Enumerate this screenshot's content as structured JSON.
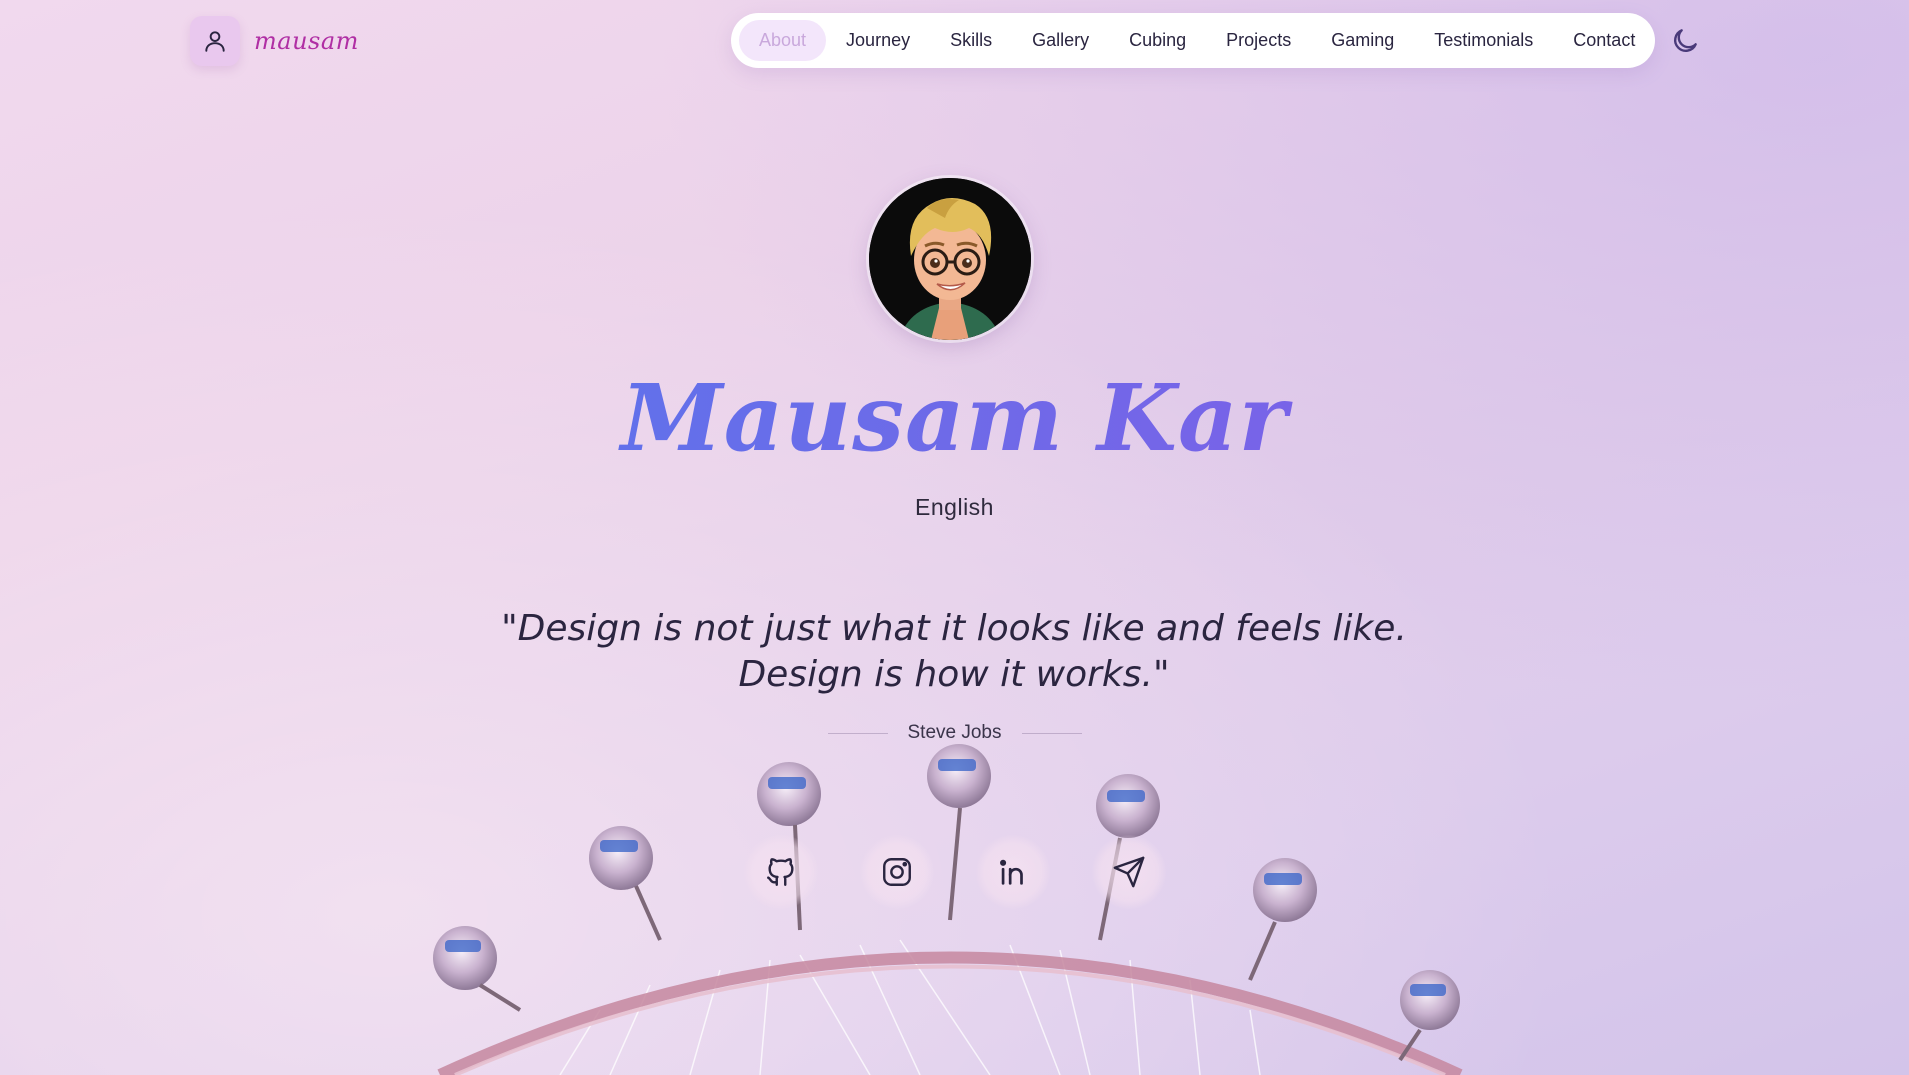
{
  "brand": {
    "name": "mausam",
    "icon": "user-icon"
  },
  "nav": {
    "items": [
      {
        "label": "About",
        "active": true
      },
      {
        "label": "Journey"
      },
      {
        "label": "Skills"
      },
      {
        "label": "Gallery"
      },
      {
        "label": "Cubing"
      },
      {
        "label": "Projects"
      },
      {
        "label": "Gaming"
      },
      {
        "label": "Testimonials"
      },
      {
        "label": "Contact"
      }
    ],
    "theme_toggle_icon": "moon-icon"
  },
  "hero": {
    "name": "Mausam Kar",
    "language": "English",
    "quote": "\"Design is not just what it looks like and feels like. Design is how it works.\"",
    "author": "Steve Jobs"
  },
  "socials": [
    {
      "icon": "github-icon"
    },
    {
      "icon": "instagram-icon"
    },
    {
      "icon": "linkedin-icon"
    },
    {
      "icon": "send-icon"
    }
  ],
  "colors": {
    "accent": "#b02fa4",
    "name_gradient_start": "#4b7cf0",
    "name_gradient_end": "#8a56e8",
    "nav_active_bg": "#f3e6fb"
  }
}
